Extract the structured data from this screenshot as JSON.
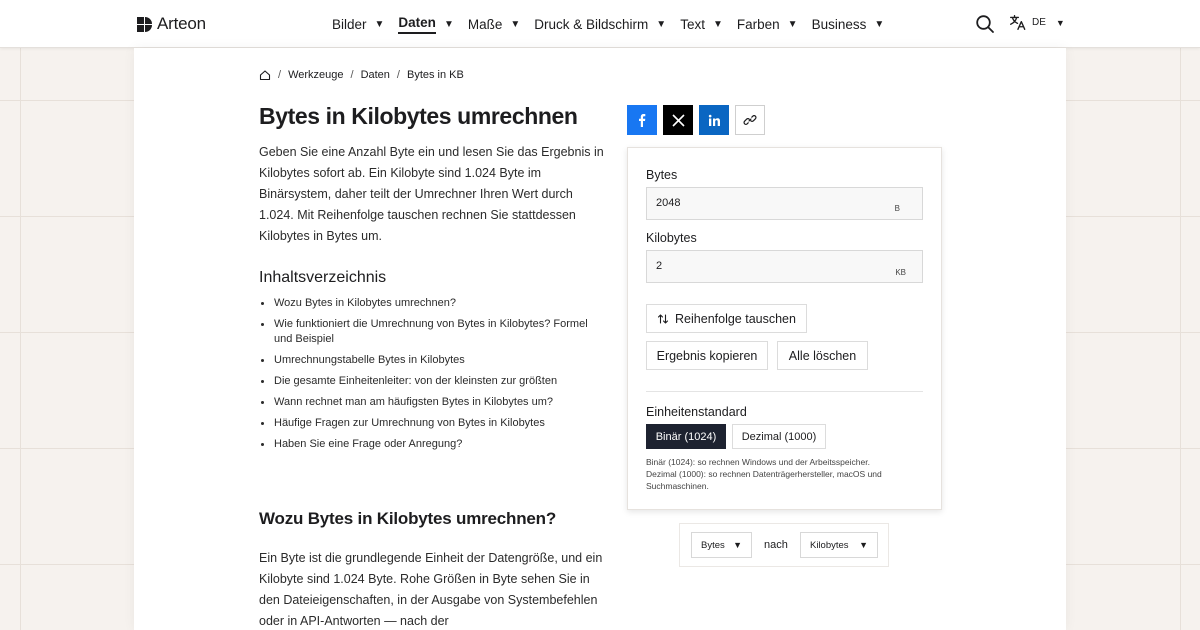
{
  "brand": {
    "name": "Arteon"
  },
  "nav": [
    {
      "label": "Bilder",
      "active": false
    },
    {
      "label": "Daten",
      "active": true
    },
    {
      "label": "Maße",
      "active": false
    },
    {
      "label": "Druck & Bildschirm",
      "active": false
    },
    {
      "label": "Text",
      "active": false
    },
    {
      "label": "Farben",
      "active": false
    },
    {
      "label": "Business",
      "active": false
    }
  ],
  "header": {
    "lang": "DE",
    "search_icon": "search-icon",
    "lang_icon": "translate-icon"
  },
  "breadcrumb": {
    "items": [
      "Werkzeuge",
      "Daten",
      "Bytes in KB"
    ]
  },
  "article": {
    "title": "Bytes in Kilobytes umrechnen",
    "intro": "Geben Sie eine Anzahl Byte ein und lesen Sie das Ergebnis in Kilobytes sofort ab. Ein Kilobyte sind 1.024 Byte im Binärsystem, daher teilt der Umrechner Ihren Wert durch 1.024. Mit Reihenfolge tauschen rechnen Sie stattdessen Kilobytes in Bytes um.",
    "toc_title": "Inhaltsverzeichnis",
    "toc": [
      "Wozu Bytes in Kilobytes umrechnen?",
      "Wie funktioniert die Umrechnung von Bytes in Kilobytes? Formel und Beispiel",
      "Umrechnungstabelle Bytes in Kilobytes",
      "Die gesamte Einheitenleiter: von der kleinsten zur größten",
      "Wann rechnet man am häufigsten Bytes in Kilobytes um?",
      "Häufige Fragen zur Umrechnung von Bytes in Kilobytes",
      "Haben Sie eine Frage oder Anregung?"
    ],
    "section_title": "Wozu Bytes in Kilobytes umrechnen?",
    "section_text": "Ein Byte ist die grundlegende Einheit der Datengröße, und ein Kilobyte sind 1.024 Byte. Rohe Größen in Byte sehen Sie in den Dateieigenschaften, in der Ausgabe von Systembefehlen oder in API-Antworten — nach der"
  },
  "share": {
    "facebook": "facebook-icon",
    "x": "x-icon",
    "linkedin": "linkedin-icon",
    "link": "link-icon"
  },
  "converter": {
    "bytes_label": "Bytes",
    "bytes_value": "2048",
    "bytes_unit": "B",
    "kb_label": "Kilobytes",
    "kb_value": "2",
    "kb_unit": "KB",
    "swap_label": "Reihenfolge tauschen",
    "copy_label": "Ergebnis kopieren",
    "clear_label": "Alle löschen",
    "standard_label": "Einheitenstandard",
    "binary_label": "Binär (1024)",
    "decimal_label": "Dezimal (1000)",
    "note_line1": "Binär (1024): so rechnen Windows und der Arbeitsspeicher.",
    "note_line2": "Dezimal (1000): so rechnen Datenträgerhersteller, macOS und Suchmaschinen."
  },
  "unit_select": {
    "from": "Bytes",
    "connector": "nach",
    "to": "Kilobytes"
  },
  "colors": {
    "accent_dark": "#1d2230",
    "facebook": "#1877f2",
    "linkedin": "#0a66c2",
    "x": "#000000"
  }
}
